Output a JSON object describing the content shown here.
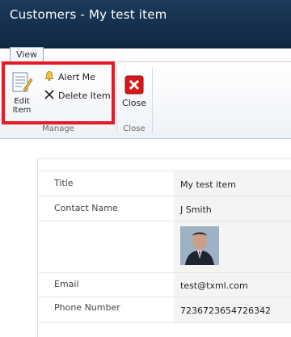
{
  "window": {
    "title": "Customers - My test item"
  },
  "ribbon": {
    "tab_label": "View",
    "groups": {
      "manage": {
        "label": "Manage",
        "edit_item": "Edit Item",
        "alert_me": "Alert Me",
        "delete_item": "Delete Item"
      },
      "close": {
        "label": "Close",
        "close_button": "Close"
      }
    }
  },
  "item": {
    "fields": [
      {
        "label": "Title",
        "value": "My test item"
      },
      {
        "label": "Contact Name",
        "value": "J Smith"
      },
      {
        "label": "",
        "value": ""
      },
      {
        "label": "Email",
        "value": "test@txml.com"
      },
      {
        "label": "Phone Number",
        "value": "7236723654726342"
      }
    ]
  },
  "colors": {
    "titlebar": "#17324f",
    "highlight": "#e21b24",
    "close_icon": "#d7191b"
  }
}
